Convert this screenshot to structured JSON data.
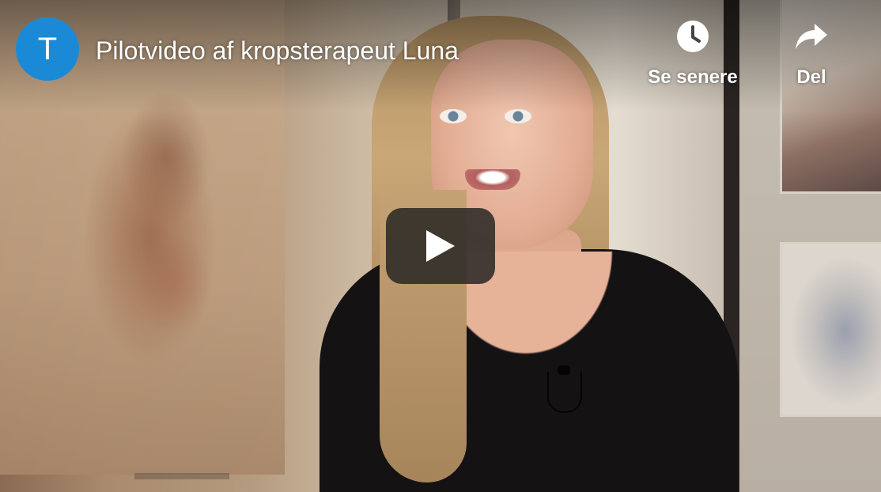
{
  "video": {
    "title": "Pilotvideo af kropsterapeut Luna",
    "channel_initial": "T",
    "channel_color": "#1a8ad6"
  },
  "actions": {
    "watch_later": {
      "label": "Se senere",
      "icon": "clock-icon"
    },
    "share": {
      "label": "Del",
      "icon": "share-arrow-icon"
    }
  },
  "play_button": {
    "icon": "play-icon",
    "color": "#212121"
  }
}
